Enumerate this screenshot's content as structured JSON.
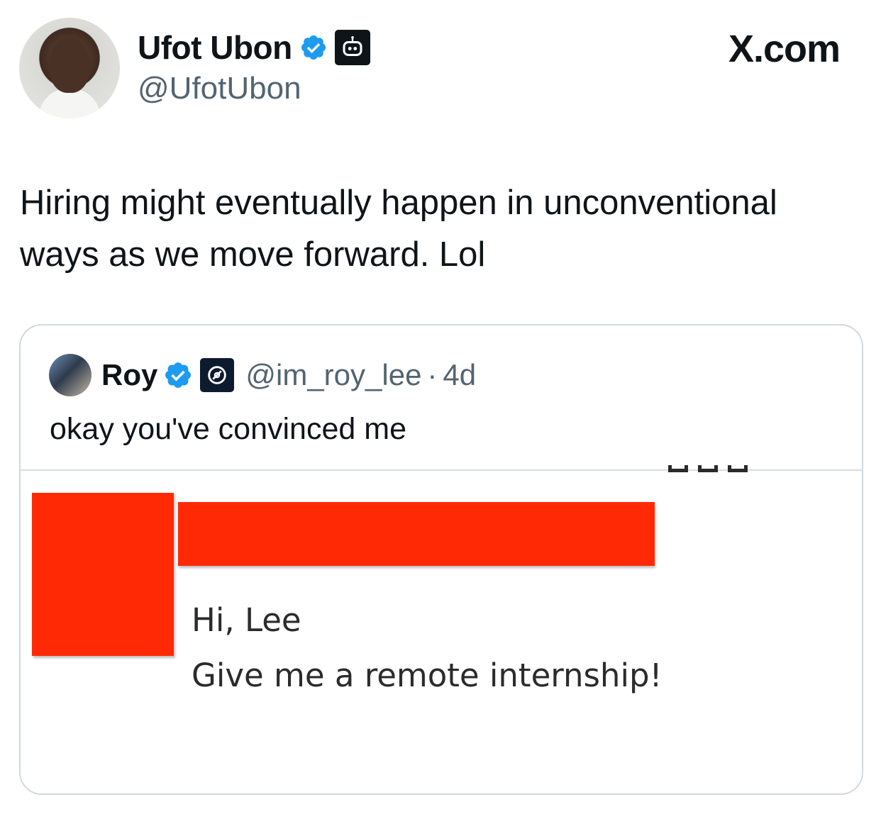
{
  "author": {
    "display_name": "Ufot Ubon",
    "handle": "@UfotUbon",
    "avatar": "profile-photo",
    "verified_icon": "verified-checkmark-icon",
    "badge_icon": "robot-badge-icon"
  },
  "brand": {
    "label": "X.com"
  },
  "tweet": {
    "text": "Hiring might eventually happen in unconventional ways as we move forward. Lol"
  },
  "quote": {
    "display_name": "Roy",
    "handle": "@im_roy_lee",
    "separator": "·",
    "time": "4d",
    "text": "okay you've convinced me",
    "verified_icon": "verified-checkmark-icon",
    "badge_icon": "org-badge-icon"
  },
  "media": {
    "greeting": "Hi, Lee",
    "message": "Give me a remote internship!",
    "redaction_color": "#ff2a05"
  },
  "colors": {
    "verified_blue": "#1d9bf0",
    "text_primary": "#0f1419",
    "text_secondary": "#536471",
    "border": "#cfd9de"
  }
}
